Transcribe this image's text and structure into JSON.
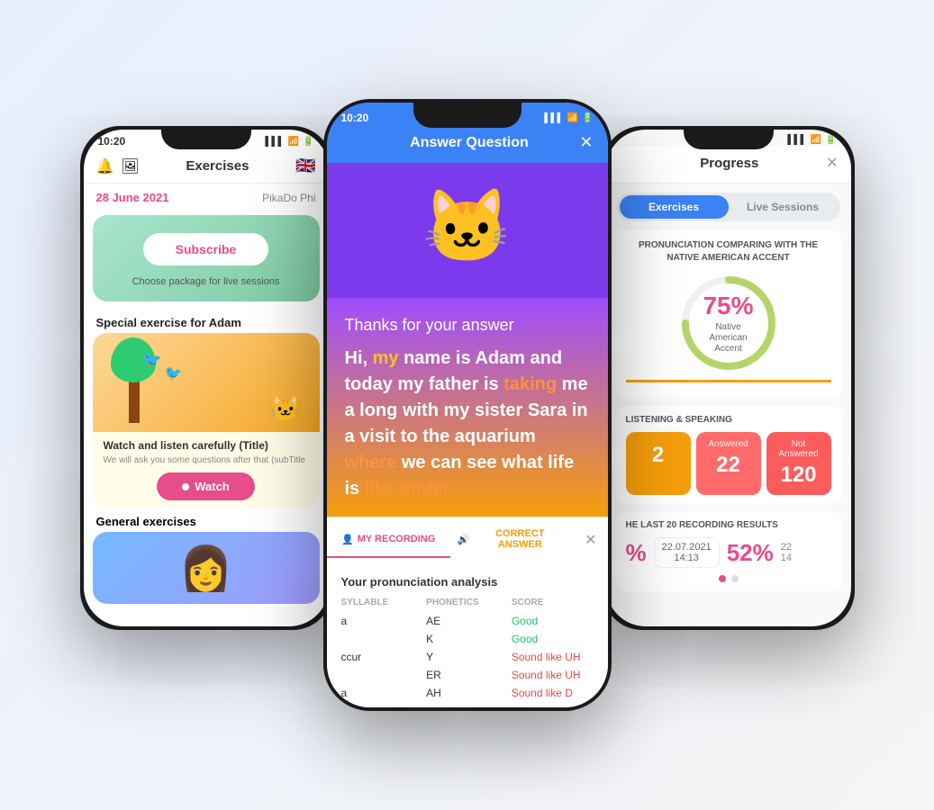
{
  "left_phone": {
    "status_bar": {
      "time": "10:20",
      "icons": "●● 📶 🔋"
    },
    "header": {
      "title": "Exercises",
      "icons": [
        "🔔",
        "🖼"
      ]
    },
    "date_row": {
      "date": "28 June 2021",
      "user": "PikaDo Phi"
    },
    "subscribe_banner": {
      "button_label": "Subscribe",
      "subtitle": "Choose package for live sessions"
    },
    "special_exercise": {
      "section_title": "Special exercise for Adam",
      "card_title": "Watch and listen carefully (Title)",
      "card_subtitle": "We will ask you some questions after that (subTitle",
      "watch_button": "Watch"
    },
    "general": {
      "section_title": "General exercises"
    }
  },
  "center_phone": {
    "status_bar": {
      "time": "10:20"
    },
    "header": {
      "title": "Answer Question",
      "close": "✕"
    },
    "thanks_text": "Thanks for your answer",
    "answer_text_parts": [
      {
        "text": "Hi, ",
        "color": "white"
      },
      {
        "text": "my",
        "color": "yellow"
      },
      {
        "text": " name is Adam and today my father is ",
        "color": "white"
      },
      {
        "text": "taking",
        "color": "orange"
      },
      {
        "text": " me a long with my sister Sara in a visit to the aquarium ",
        "color": "white"
      },
      {
        "text": "where",
        "color": "orange"
      },
      {
        "text": " we can see what life is ",
        "color": "white"
      },
      {
        "text": "like under",
        "color": "orange"
      }
    ],
    "recording_tab": {
      "label": "MY RECORDING",
      "icon": "👤"
    },
    "correct_tab": {
      "label": "CORRECT ANSWER",
      "icon": "🔊"
    },
    "pronunciation": {
      "title": "Your pronunciation analysis",
      "columns": [
        "SYLLABLE",
        "PHONETICS",
        "SCORE"
      ],
      "rows": [
        {
          "syllable": "a",
          "phonetic": "AE",
          "score": "Good",
          "good": true
        },
        {
          "syllable": "",
          "phonetic": "K",
          "score": "Good",
          "good": true
        },
        {
          "syllable": "ccur",
          "phonetic": "Y",
          "score": "Sound like UH",
          "good": false
        },
        {
          "syllable": "",
          "phonetic": "ER",
          "score": "Sound like UH",
          "good": false
        },
        {
          "syllable": "a",
          "phonetic": "AH",
          "score": "Sound like D",
          "good": false
        }
      ]
    }
  },
  "right_phone": {
    "status_bar": {
      "time": ""
    },
    "header": {
      "title": "Progress",
      "close": "✕"
    },
    "tabs": {
      "exercises": "Exercises",
      "live_sessions": "Live Sessions"
    },
    "pronunciation_section": {
      "title": "PRONUNCIATION COMPARING WITH THE NATIVE AMERICAN ACCENT",
      "percent": "75%",
      "percent_label": "Native American\nAccent"
    },
    "listening_section": {
      "title": "LISTENING & SPEAKING",
      "stats": [
        {
          "label": "",
          "value": "2",
          "color": "orange"
        },
        {
          "label": "Answered",
          "value": "22",
          "color": "coral"
        },
        {
          "label": "Not Answered",
          "value": "120",
          "color": "red"
        }
      ]
    },
    "recording_results": {
      "title": "HE LAST 20 RECORDING RESULTS",
      "entries": [
        {
          "percent": "%",
          "date": "22.07.2021\n14:13",
          "value": "52%"
        }
      ]
    }
  }
}
